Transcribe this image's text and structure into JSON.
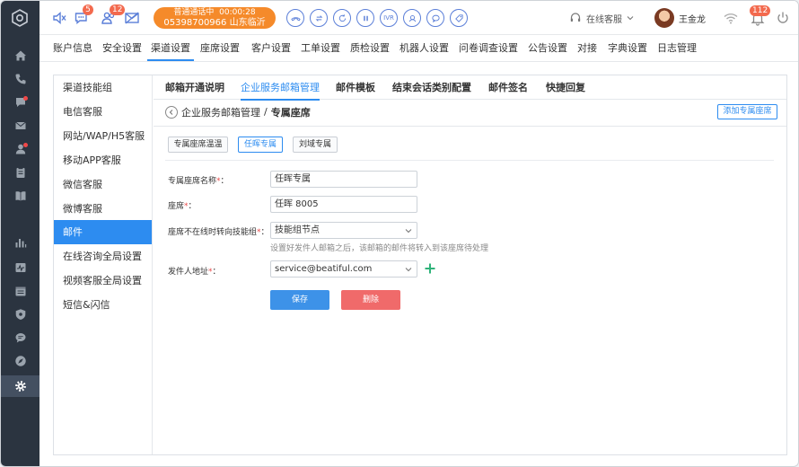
{
  "topbar": {
    "badges": {
      "chat": "5",
      "users": "12",
      "alerts": "112"
    },
    "call": {
      "status": "普通通话中",
      "timer": "00:00:28",
      "number": "05398700966 山东临沂"
    },
    "controls": {
      "ivr_label": "IVR"
    },
    "agent_status": "在线客服",
    "user_name": "王金龙"
  },
  "menu": {
    "items": [
      "账户信息",
      "安全设置",
      "渠道设置",
      "座席设置",
      "客户设置",
      "工单设置",
      "质检设置",
      "机器人设置",
      "问卷调查设置",
      "公告设置",
      "对接",
      "字典设置",
      "日志管理"
    ],
    "active": "渠道设置"
  },
  "subnav": {
    "items": [
      "渠道技能组",
      "电信客服",
      "网站/WAP/H5客服",
      "移动APP客服",
      "微信客服",
      "微博客服",
      "邮件",
      "在线咨询全局设置",
      "视频客服全局设置",
      "短信&闪信"
    ],
    "active": "邮件"
  },
  "tabs": {
    "items": [
      "邮箱开通说明",
      "企业服务邮箱管理",
      "邮件模板",
      "结束会话类别配置",
      "邮件签名",
      "快捷回复"
    ],
    "active": "企业服务邮箱管理"
  },
  "breadcrumb": {
    "parent": "企业服务邮箱管理",
    "separator": "/",
    "current": "专属座席"
  },
  "add_button": "添加专属座席",
  "chips": [
    "专属座席温温",
    "任晖专属",
    "刘域专属"
  ],
  "form": {
    "name_label": "专属座席名称",
    "name_value": "任晖专属",
    "seat_label": "座席",
    "seat_value": "任晖 8005",
    "offline_label": "座席不在线时转向技能组",
    "offline_value": "技能组节点",
    "offline_hint": "设置好发件人邮箱之后，该邮箱的邮件将转入到该座席待处理",
    "sender_label": "发件人地址",
    "sender_value": "service@beatiful.com",
    "required_mark": "*",
    "colon": "："
  },
  "buttons": {
    "save": "保存",
    "delete": "删除"
  },
  "colors": {
    "accent": "#2d8cf0",
    "call": "#f58a2a",
    "danger": "#f06a6a",
    "rail": "#2b3440"
  }
}
